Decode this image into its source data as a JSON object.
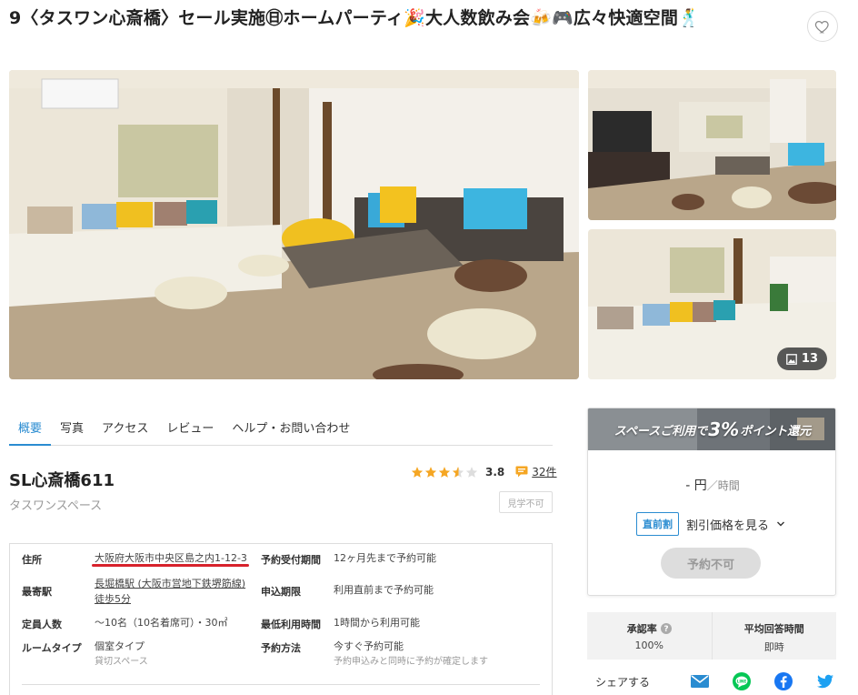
{
  "listing": {
    "title": "9〈タスワン心斎橋〉セール実施㊐ホームパーティ🎉大人数飲み会🍻🎮広々快適空間🕺",
    "photo_count": "13"
  },
  "tabs": [
    {
      "label": "概要",
      "active": true
    },
    {
      "label": "写真"
    },
    {
      "label": "アクセス"
    },
    {
      "label": "レビュー"
    },
    {
      "label": "ヘルプ・お問い合わせ"
    }
  ],
  "space": {
    "name": "SL心斎橋611",
    "owner": "タスワンスペース",
    "rating": "3.8",
    "rating_value": 3.8,
    "review_count": "32件",
    "visibility": "見学不可"
  },
  "info": {
    "address_label": "住所",
    "address": "大阪府大阪市中央区島之内1-12-3",
    "reservation_label": "予約受付期間",
    "reservation": "12ヶ月先まで予約可能",
    "station_label": "最寄駅",
    "station": "長堀橋駅 (大阪市営地下鉄堺筋線)",
    "station_walk": "徒歩5分",
    "apply_label": "申込期限",
    "apply": "利用直前まで予約可能",
    "capacity_label": "定員人数",
    "capacity": "～10名（10名着席可）・30㎡",
    "min_time_label": "最低利用時間",
    "min_time": "1時間から利用可能",
    "room_type_label": "ルームタイプ",
    "room_type": "個室タイプ",
    "room_type_sub": "貸切スペース",
    "method_label": "予約方法",
    "method": "今すぐ予約可能",
    "method_sub": "予約申込みと同時に予約が確定します"
  },
  "booking": {
    "promo_pre": "スペースご利用で",
    "promo_big": "3%",
    "promo_post": "ポイント還元",
    "price": "- 円",
    "price_unit": "／時間",
    "discount_badge": "直前割",
    "discount_link": "割引価格を見る",
    "book_button": "予約不可"
  },
  "stats": {
    "approval_label": "承認率",
    "approval": "100%",
    "response_label": "平均回答時間",
    "response": "即時"
  },
  "share": {
    "label": "シェアする",
    "icons": [
      "mail-icon",
      "line-icon",
      "facebook-icon",
      "twitter-icon"
    ]
  },
  "colors": {
    "accent": "#2a8cd1",
    "star": "#f5a623",
    "underline_red": "#d7222c",
    "line_green": "#06c755",
    "facebook_blue": "#1877f2",
    "twitter_blue": "#1da1f2"
  }
}
